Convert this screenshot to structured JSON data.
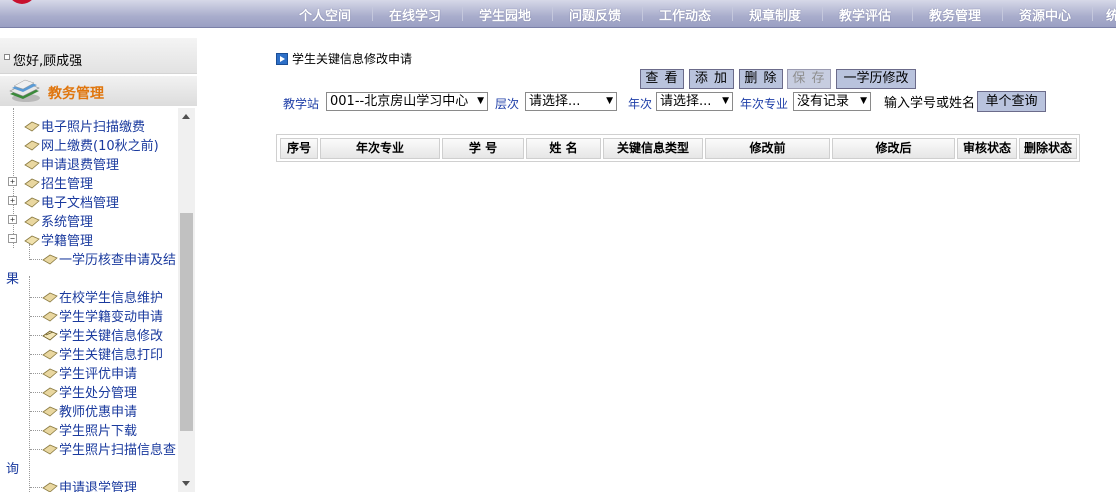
{
  "nav": {
    "items": [
      "个人空间",
      "在线学习",
      "学生园地",
      "问题反馈",
      "工作动态",
      "规章制度",
      "教学评估",
      "教务管理",
      "资源中心",
      "统"
    ]
  },
  "sidebar": {
    "greeting": "您好,顾成强",
    "module_title": "教务管理",
    "tree": [
      {
        "label": "电子照片扫描缴费"
      },
      {
        "label": "网上缴费(10秋之前)"
      },
      {
        "label": "申请退费管理"
      },
      {
        "label": "招生管理"
      },
      {
        "label": "电子文档管理"
      },
      {
        "label": "系统管理"
      },
      {
        "label": "学籍管理"
      },
      {
        "label": "一学历核查申请及结",
        "tail": "果"
      },
      {
        "label": "在校学生信息维护"
      },
      {
        "label": "学生学籍变动申请"
      },
      {
        "label": "学生关键信息修改"
      },
      {
        "label": "学生关键信息打印"
      },
      {
        "label": "学生评优申请"
      },
      {
        "label": "学生处分管理"
      },
      {
        "label": "教师优惠申请"
      },
      {
        "label": "学生照片下载"
      },
      {
        "label": "学生照片扫描信息查",
        "tail": "询"
      },
      {
        "label": "申请退学管理"
      }
    ]
  },
  "main": {
    "breadcrumb": "学生关键信息修改申请",
    "toolbar": {
      "view": "查 看",
      "add": "添 加",
      "delete": "删 除",
      "save": "保 存",
      "edu_modify": "一学历修改"
    },
    "filters": {
      "station_label": "教学站",
      "station_value": "001--北京房山学习中心",
      "level_label": "层次",
      "level_value": "请选择...",
      "year_label": "年次",
      "year_value": "请选择...",
      "year_major_label": "年次专业",
      "year_major_value": "没有记录",
      "search_hint": "输入学号或姓名",
      "query_button": "单个查询"
    },
    "table": {
      "columns": [
        "序号",
        "年次专业",
        "学 号",
        "姓 名",
        "关键信息类型",
        "修改前",
        "修改后",
        "审核状态",
        "删除状态"
      ]
    }
  }
}
